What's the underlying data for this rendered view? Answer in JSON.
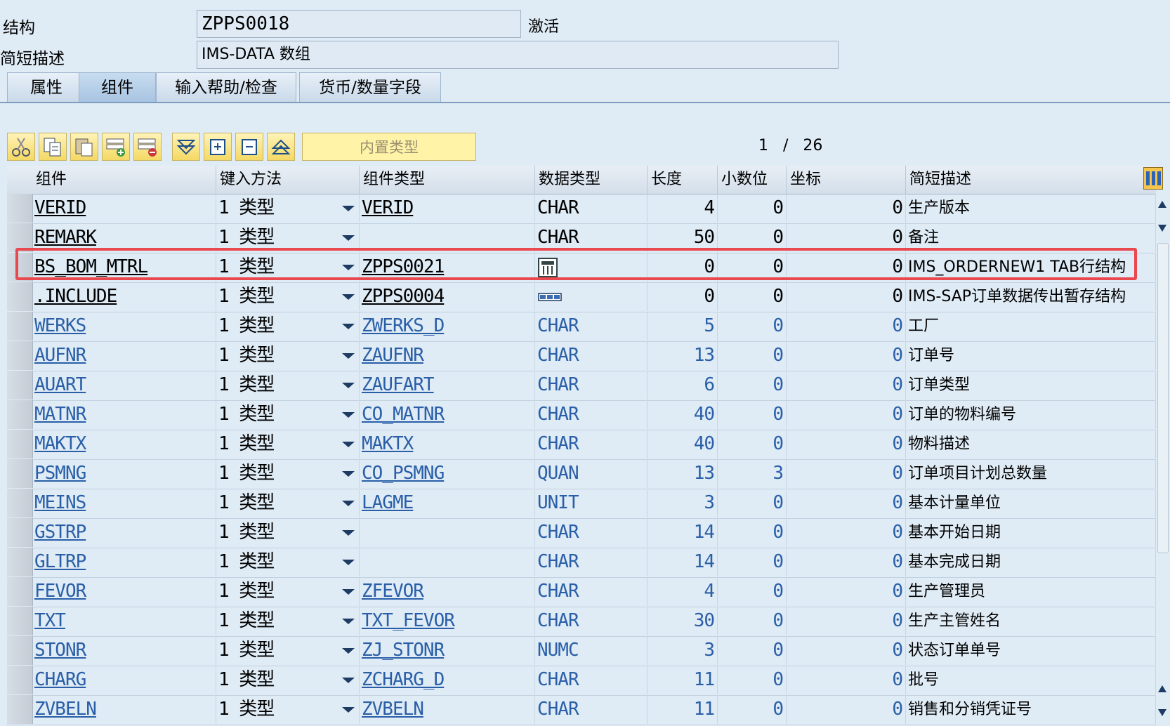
{
  "header": {
    "structure_label": "结构",
    "structure_value": "ZPPS0018",
    "status": "激活",
    "short_desc_label": "简短描述",
    "short_desc_value": "IMS-DATA 数组"
  },
  "tabs": [
    {
      "label": "属性",
      "active": false
    },
    {
      "label": "组件",
      "active": true
    },
    {
      "label": "输入帮助/检查",
      "active": false
    },
    {
      "label": "货币/数量字段",
      "active": false
    }
  ],
  "toolbar": {
    "buttons": [
      "cut-icon",
      "copy-icon",
      "paste-icon",
      "insert-row-icon",
      "delete-row-icon",
      "expand-all-icon",
      "insert-structure-icon",
      "collapse-icon",
      "scroll-top-icon"
    ],
    "builtin_type_label": "内置类型",
    "pager_current": "1",
    "pager_sep": "/",
    "pager_total": "26"
  },
  "table": {
    "columns": [
      "组件",
      "键入方法",
      "组件类型",
      "数据类型",
      "长度",
      "小数位",
      "坐标",
      "简短描述"
    ],
    "rows": [
      {
        "component": "VERID",
        "method": "1 类型",
        "comp_type": "VERID",
        "data_type": "CHAR",
        "length": "4",
        "decimals": "0",
        "coord": "0",
        "desc": "生产版本",
        "color": "black"
      },
      {
        "component": "REMARK",
        "method": "1 类型",
        "comp_type": "",
        "data_type": "CHAR",
        "length": "50",
        "decimals": "0",
        "coord": "0",
        "desc": "备注",
        "color": "black"
      },
      {
        "component": "BS_BOM_MTRL",
        "method": "1 类型",
        "comp_type": "ZPPS0021",
        "data_type": "",
        "data_icon": "table-type-icon",
        "length": "0",
        "decimals": "0",
        "coord": "0",
        "desc": "IMS_ORDERNEW1 TAB行结构",
        "color": "black"
      },
      {
        "component": ".INCLUDE",
        "method": "1 类型",
        "comp_type": "ZPPS0004",
        "data_type": "",
        "data_icon": "structure-icon",
        "length": "0",
        "decimals": "0",
        "coord": "0",
        "desc": "IMS-SAP订单数据传出暂存结构",
        "color": "black"
      },
      {
        "component": "WERKS",
        "method": "1 类型",
        "comp_type": "ZWERKS_D",
        "data_type": "CHAR",
        "length": "5",
        "decimals": "0",
        "coord": "0",
        "desc": "工厂",
        "color": "blue"
      },
      {
        "component": "AUFNR",
        "method": "1 类型",
        "comp_type": "ZAUFNR",
        "data_type": "CHAR",
        "length": "13",
        "decimals": "0",
        "coord": "0",
        "desc": "订单号",
        "color": "blue"
      },
      {
        "component": "AUART",
        "method": "1 类型",
        "comp_type": "ZAUFART",
        "data_type": "CHAR",
        "length": "6",
        "decimals": "0",
        "coord": "0",
        "desc": "订单类型",
        "color": "blue"
      },
      {
        "component": "MATNR",
        "method": "1 类型",
        "comp_type": "CO_MATNR",
        "data_type": "CHAR",
        "length": "40",
        "decimals": "0",
        "coord": "0",
        "desc": "订单的物料编号",
        "color": "blue"
      },
      {
        "component": "MAKTX",
        "method": "1 类型",
        "comp_type": "MAKTX",
        "data_type": "CHAR",
        "length": "40",
        "decimals": "0",
        "coord": "0",
        "desc": "物料描述",
        "color": "blue"
      },
      {
        "component": "PSMNG",
        "method": "1 类型",
        "comp_type": "CO_PSMNG",
        "data_type": "QUAN",
        "length": "13",
        "decimals": "3",
        "coord": "0",
        "desc": "订单项目计划总数量",
        "color": "blue"
      },
      {
        "component": "MEINS",
        "method": "1 类型",
        "comp_type": "LAGME",
        "data_type": "UNIT",
        "length": "3",
        "decimals": "0",
        "coord": "0",
        "desc": "基本计量单位",
        "color": "blue"
      },
      {
        "component": "GSTRP",
        "method": "1 类型",
        "comp_type": "",
        "data_type": "CHAR",
        "length": "14",
        "decimals": "0",
        "coord": "0",
        "desc": "基本开始日期",
        "color": "blue"
      },
      {
        "component": "GLTRP",
        "method": "1 类型",
        "comp_type": "",
        "data_type": "CHAR",
        "length": "14",
        "decimals": "0",
        "coord": "0",
        "desc": "基本完成日期",
        "color": "blue"
      },
      {
        "component": "FEVOR",
        "method": "1 类型",
        "comp_type": "ZFEVOR",
        "data_type": "CHAR",
        "length": "4",
        "decimals": "0",
        "coord": "0",
        "desc": "生产管理员",
        "color": "blue"
      },
      {
        "component": "TXT",
        "method": "1 类型",
        "comp_type": "TXT_FEVOR",
        "data_type": "CHAR",
        "length": "30",
        "decimals": "0",
        "coord": "0",
        "desc": "生产主管姓名",
        "color": "blue"
      },
      {
        "component": "STONR",
        "method": "1 类型",
        "comp_type": "ZJ_STONR",
        "data_type": "NUMC",
        "length": "3",
        "decimals": "0",
        "coord": "0",
        "desc": "状态订单单号",
        "color": "blue"
      },
      {
        "component": "CHARG",
        "method": "1 类型",
        "comp_type": "ZCHARG_D",
        "data_type": "CHAR",
        "length": "11",
        "decimals": "0",
        "coord": "0",
        "desc": "批号",
        "color": "blue"
      },
      {
        "component": "ZVBELN",
        "method": "1 类型",
        "comp_type": "ZVBELN",
        "data_type": "CHAR",
        "length": "11",
        "decimals": "0",
        "coord": "0",
        "desc": "销售和分销凭证号",
        "color": "blue"
      }
    ]
  }
}
